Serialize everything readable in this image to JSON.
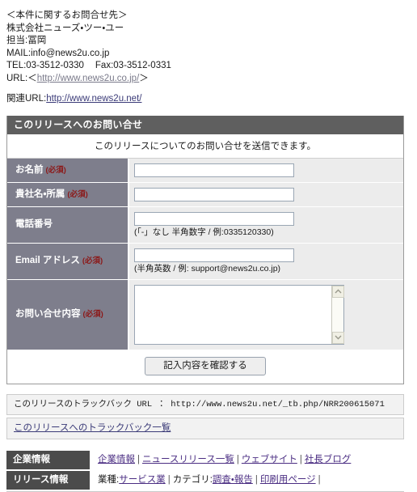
{
  "contact": {
    "heading": "＜本件に関するお問合せ先＞",
    "company": "株式会社ニューズ・ツー・ユー",
    "person": "担当:冨岡",
    "mail": "MAIL:info@news2u.co.jp",
    "tel": "TEL:03-3512-0330",
    "fax": "Fax:03-3512-0331",
    "url_label": "URL:＜",
    "url_text": "http://www.news2u.co.jp/",
    "url_close": "＞",
    "related_label": "関連URL:",
    "related_url_text": "http://www.news2u.net/"
  },
  "form": {
    "title": "このリリースへのお問い合せ",
    "intro": "このリリースについてのお問い合せを送信できます。",
    "required_mark": "(必須)",
    "rows": [
      {
        "label": "お名前",
        "required": true,
        "value": "",
        "hint": ""
      },
      {
        "label": "貴社名・所属",
        "required": true,
        "value": "",
        "hint": ""
      },
      {
        "label": "電話番号",
        "required": false,
        "value": "",
        "hint": "(「-」なし 半角数字 / 例:0335120330)"
      },
      {
        "label": "Email アドレス",
        "required": true,
        "value": "",
        "hint": "(半角英数 / 例: support@news2u.co.jp)"
      },
      {
        "label": "お問い合せ内容",
        "required": true,
        "value": "",
        "hint": ""
      }
    ],
    "submit_label": "記入内容を確認する"
  },
  "trackback": {
    "url_line": "このリリースのトラックバック URL ： http://www.news2u.net/_tb.php/NRR200615071",
    "list_link": "このリリースへのトラックバック一覧"
  },
  "footer": {
    "rows": [
      {
        "label": "企業情報",
        "items": [
          {
            "text": "企業情報",
            "link": true
          },
          {
            "text": "ニュースリリース一覧",
            "link": true
          },
          {
            "text": "ウェブサイト",
            "link": true
          },
          {
            "text": "社長ブログ",
            "link": true
          }
        ],
        "trailing_sep": false
      },
      {
        "label": "リリース情報",
        "items": [
          {
            "text": "業種:",
            "link": false,
            "nosep": true
          },
          {
            "text": "サービス業",
            "link": true
          },
          {
            "text": "カテゴリ:",
            "link": false,
            "nosep": true
          },
          {
            "text": "調査・報告",
            "link": true
          },
          {
            "text": "印刷用ページ",
            "link": true
          }
        ],
        "trailing_sep": true
      }
    ]
  },
  "colors": {
    "form_header_bg": "#5f5f5f",
    "label_bg": "#7e7e8c",
    "field_bg": "#ececec",
    "footer_label_bg": "#4b4b4b",
    "required_red": "#8c1818",
    "link_purple": "#4b2e83"
  }
}
